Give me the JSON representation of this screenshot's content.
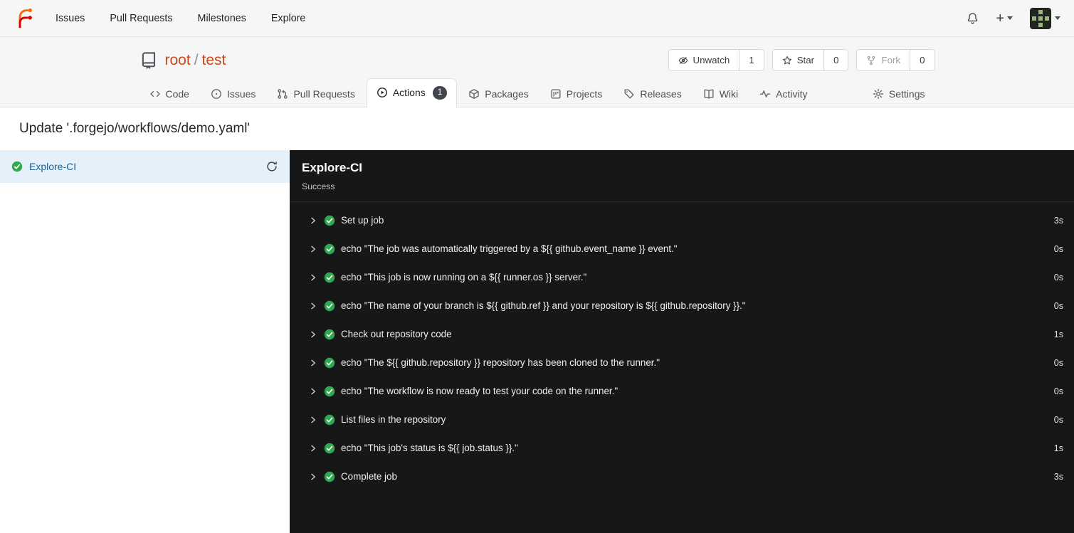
{
  "navbar": {
    "links": [
      "Issues",
      "Pull Requests",
      "Milestones",
      "Explore"
    ],
    "new_button": "+"
  },
  "repo": {
    "owner": "root",
    "slash": "/",
    "name": "test",
    "watch": {
      "label": "Unwatch",
      "count": "1"
    },
    "star": {
      "label": "Star",
      "count": "0"
    },
    "fork": {
      "label": "Fork",
      "count": "0"
    }
  },
  "tabs": {
    "items": [
      {
        "label": "Code"
      },
      {
        "label": "Issues"
      },
      {
        "label": "Pull Requests"
      },
      {
        "label": "Actions",
        "badge": "1",
        "active": true
      },
      {
        "label": "Packages"
      },
      {
        "label": "Projects"
      },
      {
        "label": "Releases"
      },
      {
        "label": "Wiki"
      },
      {
        "label": "Activity"
      },
      {
        "label": "Settings"
      }
    ]
  },
  "page": {
    "title": "Update '.forgejo/workflows/demo.yaml'"
  },
  "jobs_sidebar": {
    "items": [
      {
        "label": "Explore-CI",
        "status": "success",
        "selected": true
      }
    ]
  },
  "run_panel": {
    "title": "Explore-CI",
    "status": "Success",
    "steps": [
      {
        "label": "Set up job",
        "duration": "3s"
      },
      {
        "label": "echo \"The job was automatically triggered by a ${{ github.event_name }} event.\"",
        "duration": "0s"
      },
      {
        "label": "echo \"This job is now running on a ${{ runner.os }} server.\"",
        "duration": "0s"
      },
      {
        "label": "echo \"The name of your branch is ${{ github.ref }} and your repository is ${{ github.repository }}.\"",
        "duration": "0s"
      },
      {
        "label": "Check out repository code",
        "duration": "1s"
      },
      {
        "label": "echo \"The ${{ github.repository }} repository has been cloned to the runner.\"",
        "duration": "0s"
      },
      {
        "label": "echo \"The workflow is now ready to test your code on the runner.\"",
        "duration": "0s"
      },
      {
        "label": "List files in the repository",
        "duration": "0s"
      },
      {
        "label": "echo \"This job's status is ${{ job.status }}.\"",
        "duration": "1s"
      },
      {
        "label": "Complete job",
        "duration": "3s"
      }
    ]
  },
  "icons": {
    "forgejo-logo": "forgejo-branch-f",
    "bell-icon": "notification-bell",
    "plus-icon": "+",
    "caret-down-icon": "▾",
    "avatar": "user-identicon",
    "repo-icon": "repository-book",
    "eye-off-icon": "unwatch-eye-slash",
    "star-icon": "☆",
    "fork-icon": "git-fork",
    "code-icon": "</>",
    "issue-opened-icon": "circle-dot",
    "pull-request-icon": "git-pull-request",
    "play-circle-icon": "▶",
    "package-icon": "cube",
    "project-board-icon": "kanban-columns",
    "tag-icon": "tag",
    "book-icon": "open-book",
    "pulse-icon": "activity-pulse",
    "gear-icon": "⚙",
    "sync-icon": "⟳",
    "chevron-right-icon": "›",
    "success-check-icon": "✓"
  },
  "colors": {
    "accent": "#c7491c",
    "success_green": "#2fa84f",
    "panel_bg": "#171717",
    "selected_job_bg": "#e4f1fa",
    "badge_bg": "#41464c",
    "job_link": "#1d638f"
  }
}
